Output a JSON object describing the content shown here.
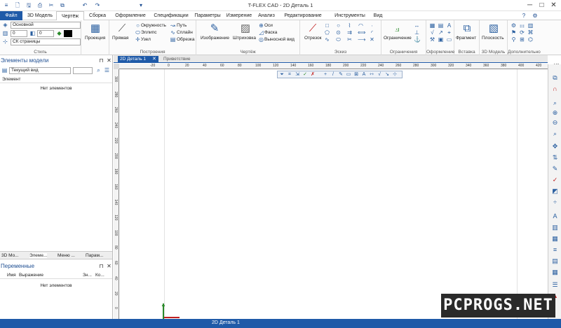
{
  "window": {
    "title": "T-FLEX CAD - 2D Деталь 1",
    "minimize": "─",
    "maximize": "□",
    "close": "✕"
  },
  "quick_access": [
    "≡",
    "🗋",
    "🖫",
    "⎙",
    "✂",
    "⧉",
    "↶",
    "↷",
    "▾"
  ],
  "topright": [
    "◉",
    "?",
    "⚙"
  ],
  "menu": {
    "file": "Файл",
    "tabs": [
      "3D Модель",
      "Чертёж",
      "Сборка",
      "Оформление",
      "Спецификации",
      "Параметры",
      "Измерение",
      "Анализ",
      "Редактирование",
      "Инструменты",
      "Вид"
    ],
    "active": "Чертёж"
  },
  "ribbon": {
    "style": {
      "layer": "Основной",
      "width1": "0",
      "width2": "0",
      "cs": "СК страницы",
      "label": "Стиль"
    },
    "projection": "Проекция",
    "build": {
      "line": "Прямая",
      "items": [
        "Окружность",
        "Эллипс",
        "Узел",
        "Путь",
        "Сплайн",
        "Обрезка"
      ],
      "label": "Построения"
    },
    "drawing": {
      "image": "Изображение",
      "hatch": "Штриховка",
      "items": [
        "Оси",
        "Фаска",
        "Выносной вид"
      ],
      "label": "Чертёж"
    },
    "sketch": {
      "segment": "Отрезок",
      "label": "Эскиз"
    },
    "constraints": {
      "btn": "Ограничение",
      "label": "Ограничения"
    },
    "decor": {
      "label": "Оформление"
    },
    "insert": {
      "btn": "Фрагмент",
      "label": "Вставка"
    },
    "model3d": {
      "btn": "Плоскость",
      "label": "3D Модель"
    },
    "extra": {
      "label": "Дополнительно"
    }
  },
  "model_panel": {
    "title": "Элементы модели",
    "view": "Текущий вид",
    "col": "Элемент",
    "empty": "Нет элементов"
  },
  "panel_tabs": [
    "3D Мо...",
    "Элеме...",
    "Меню ...",
    "Парам..."
  ],
  "vars_panel": {
    "title": "Переменные",
    "cols": [
      "Имя",
      "Выражение",
      "Зн...",
      "Ко..."
    ],
    "empty": "Нет элементов"
  },
  "doc_tabs": {
    "active": "2D Деталь 1",
    "welcome": "Приветствие"
  },
  "ruler": {
    "h": [
      "-20",
      "0",
      "20",
      "40",
      "60",
      "80",
      "100",
      "120",
      "140",
      "160",
      "180",
      "200",
      "220",
      "240",
      "260",
      "280",
      "300",
      "320",
      "340",
      "360",
      "380",
      "400",
      "420",
      "440"
    ],
    "v": [
      "0",
      "20",
      "40",
      "60",
      "80",
      "100",
      "120",
      "140",
      "160",
      "180",
      "200",
      "220",
      "240",
      "260",
      "280",
      "300"
    ]
  },
  "status": {
    "text": "2D Деталь 1"
  },
  "watermark": "PCPROGS.NET"
}
